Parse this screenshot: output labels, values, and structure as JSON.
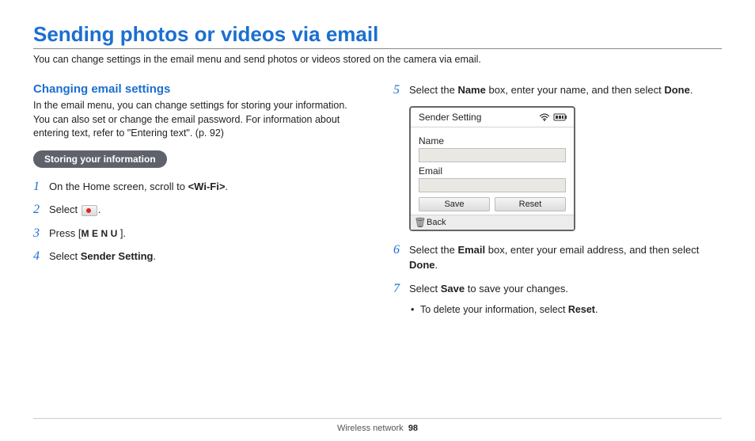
{
  "page": {
    "title": "Sending photos or videos via email",
    "intro": "You can change settings in the email menu and send photos or videos stored on the camera via email."
  },
  "left": {
    "section_title": "Changing email settings",
    "section_intro": "In the email menu, you can change settings for storing your information. You can also set or change the email password. For information about entering text, refer to \"Entering text\". (p. 92)",
    "pill": "Storing your information",
    "step1_pre": "On the Home screen, scroll to ",
    "step1_bold": "<Wi-Fi>",
    "step1_post": ".",
    "step2": "Select ",
    "step2_post": ".",
    "step3_pre": "Press [",
    "step3_menu": "MENU",
    "step3_post": "].",
    "step4_pre": "Select ",
    "step4_bold": "Sender Setting",
    "step4_post": "."
  },
  "right": {
    "step5_pre": "Select the ",
    "step5_b1": "Name",
    "step5_mid": " box, enter your name, and then select ",
    "step5_b2": "Done",
    "step5_post": ".",
    "device": {
      "title": "Sender Setting",
      "name_label": "Name",
      "email_label": "Email",
      "save": "Save",
      "reset": "Reset",
      "back": "Back"
    },
    "step6_pre": "Select the ",
    "step6_b1": "Email",
    "step6_mid": " box, enter your email address, and then select ",
    "step6_b2": "Done",
    "step6_post": ".",
    "step7_pre": "Select ",
    "step7_b1": "Save",
    "step7_post": " to save your changes.",
    "step7_sub_pre": "To delete your information, select ",
    "step7_sub_b": "Reset",
    "step7_sub_post": "."
  },
  "footer": {
    "section": "Wireless network",
    "page": "98"
  }
}
